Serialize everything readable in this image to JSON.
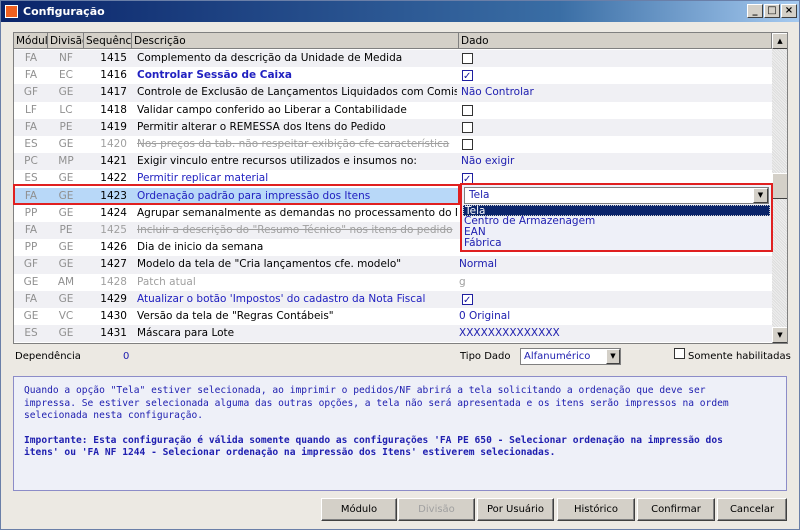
{
  "window": {
    "title": "Configuração",
    "min": "_",
    "max": "□",
    "close": "×"
  },
  "grid": {
    "headers": [
      "Módulo",
      "Divisão",
      "Sequência",
      "Descrição",
      "Dado"
    ],
    "rows": [
      {
        "modulo": "FA",
        "divisao": "NF",
        "seq": "1415",
        "descricao": "Complemento da descrição da Unidade de Medida",
        "style": "",
        "dado": {
          "type": "check",
          "checked": false
        }
      },
      {
        "modulo": "FA",
        "divisao": "EC",
        "seq": "1416",
        "descricao": "Controlar Sessão de Caixa",
        "style": "blue bold",
        "dado": {
          "type": "check",
          "checked": true
        }
      },
      {
        "modulo": "GF",
        "divisao": "GE",
        "seq": "1417",
        "descricao": "Controle de Exclusão de Lançamentos Liquidados com Comissão",
        "style": "",
        "dado": {
          "type": "text",
          "value": "Não Controlar"
        }
      },
      {
        "modulo": "LF",
        "divisao": "LC",
        "seq": "1418",
        "descricao": "Validar campo conferido ao Liberar a Contabilidade",
        "style": "",
        "dado": {
          "type": "check",
          "checked": false
        }
      },
      {
        "modulo": "FA",
        "divisao": "PE",
        "seq": "1419",
        "descricao": "Permitir alterar o REMESSA dos Itens do Pedido",
        "style": "",
        "dado": {
          "type": "check",
          "checked": false
        }
      },
      {
        "modulo": "ES",
        "divisao": "GE",
        "seq": "1420",
        "descricao": "Nos preços da tab. não respeitar exibição cfe característica",
        "style": "strike",
        "dado": {
          "type": "check",
          "checked": false
        }
      },
      {
        "modulo": "PC",
        "divisao": "MP",
        "seq": "1421",
        "descricao": "Exigir vinculo entre recursos utilizados e insumos no:",
        "style": "",
        "dado": {
          "type": "text",
          "value": "Não exigir"
        }
      },
      {
        "modulo": "ES",
        "divisao": "GE",
        "seq": "1422",
        "descricao": "Permitir replicar material",
        "style": "blue",
        "dado": {
          "type": "check",
          "checked": true
        }
      },
      {
        "modulo": "FA",
        "divisao": "GE",
        "seq": "1423",
        "descricao": "Ordenação padrão para impressão dos Itens",
        "style": "blue sel",
        "dado": {
          "type": "combo",
          "value": "Tela"
        }
      },
      {
        "modulo": "PP",
        "divisao": "GE",
        "seq": "1424",
        "descricao": "Agrupar semanalmente as demandas no processamento do MRP",
        "style": "",
        "dado": {
          "type": "text",
          "value": ""
        }
      },
      {
        "modulo": "FA",
        "divisao": "PE",
        "seq": "1425",
        "descricao": "Incluir a descrição do \"Resumo Técnico\" nos itens do pedido",
        "style": "strike",
        "dado": {
          "type": "text",
          "value": ""
        }
      },
      {
        "modulo": "PP",
        "divisao": "GE",
        "seq": "1426",
        "descricao": "Dia de inicio da semana",
        "style": "",
        "dado": {
          "type": "text",
          "value": ""
        }
      },
      {
        "modulo": "GF",
        "divisao": "GE",
        "seq": "1427",
        "descricao": "Modelo da tela de \"Cria lançamentos cfe. modelo\"",
        "style": "",
        "dado": {
          "type": "text",
          "value": "Normal"
        }
      },
      {
        "modulo": "GE",
        "divisao": "AM",
        "seq": "1428",
        "descricao": "Patch atual",
        "style": "gray",
        "dado": {
          "type": "text",
          "value": "g",
          "gray": true
        }
      },
      {
        "modulo": "FA",
        "divisao": "GE",
        "seq": "1429",
        "descricao": "Atualizar o botão 'Impostos' do cadastro da Nota Fiscal",
        "style": "blue",
        "dado": {
          "type": "check",
          "checked": true
        }
      },
      {
        "modulo": "GE",
        "divisao": "VC",
        "seq": "1430",
        "descricao": "Versão da tela de \"Regras Contábeis\"",
        "style": "",
        "dado": {
          "type": "text",
          "value": "0 Original"
        }
      },
      {
        "modulo": "ES",
        "divisao": "GE",
        "seq": "1431",
        "descricao": "Máscara para Lote",
        "style": "",
        "dado": {
          "type": "text",
          "value": "XXXXXXXXXXXXXX"
        }
      }
    ]
  },
  "dropdown": {
    "value": "Tela",
    "options": [
      "Tela",
      "Centro de Armazenagem",
      "EAN",
      "Fábrica"
    ],
    "highlighted": 0
  },
  "footer": {
    "dependencia_label": "Dependência",
    "dependencia_value": "0",
    "tipo_dado_label": "Tipo Dado",
    "tipo_dado_value": "Alfanumérico",
    "somente_label": "Somente habilitadas"
  },
  "description": {
    "text": "Quando a opção \"Tela\" estiver selecionada, ao imprimir o pedidos/NF abrirá a tela solicitando a ordenação que deve ser\nimpressa. Se estiver selecionada alguma das outras opções, a tela não será apresentada e os itens serão impressos na ordem\nselecionada nesta configuração.",
    "important": "Importante: Esta configuração é válida somente quando as configurações 'FA PE 650 - Selecionar ordenação na impressão dos\nitens' ou 'FA NF 1244 - Selecionar ordenação na impressão dos Itens' estiverem selecionadas."
  },
  "buttons": {
    "modulo": "Módulo",
    "divisao": "Divisão",
    "por_usuario": "Por Usuário",
    "historico": "Histórico",
    "confirmar": "Confirmar",
    "cancelar": "Cancelar"
  }
}
